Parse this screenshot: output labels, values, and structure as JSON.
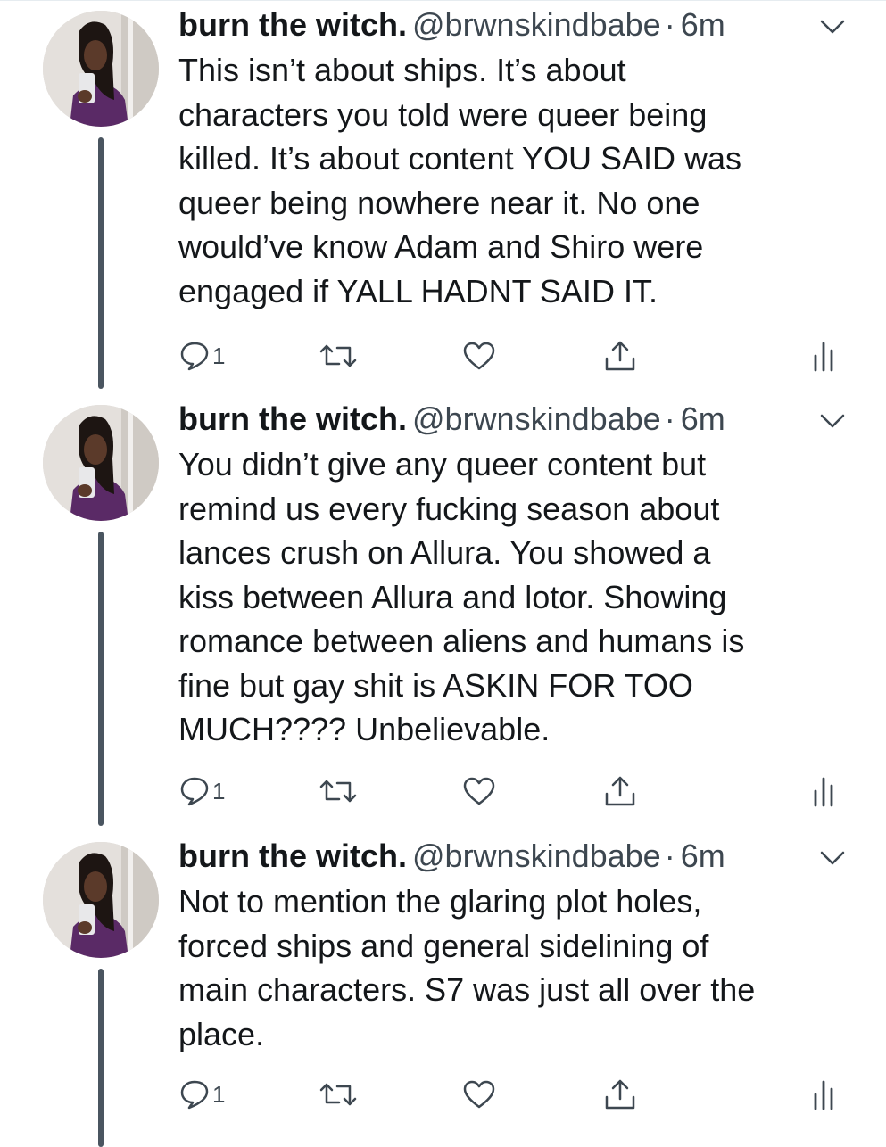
{
  "tweets": [
    {
      "display_name": "burn the witch.",
      "handle": "@brwnskindbabe",
      "separator": "·",
      "time": "6m",
      "text": "This isn’t about ships. It’s about\ncharacters you told were queer being\nkilled. It’s about content YOU SAID was\nqueer being nowhere near it. No one\nwould’ve know Adam and Shiro were\nengaged if YALL HADNT SAID IT.",
      "reply_count": "1"
    },
    {
      "display_name": "burn the witch.",
      "handle": "@brwnskindbabe",
      "separator": "·",
      "time": "6m",
      "text": "You didn’t give any queer content but\nremind us every fucking season about\nlances crush on Allura. You showed a\nkiss between Allura and lotor. Showing\nromance between aliens and humans is\nfine but gay shit is ASKIN FOR TOO\nMUCH???? Unbelievable.",
      "reply_count": "1"
    },
    {
      "display_name": "burn the witch.",
      "handle": "@brwnskindbabe",
      "separator": "·",
      "time": "6m",
      "text": "Not to mention the glaring plot holes,\nforced ships and general sidelining of\nmain characters. S7 was just all over the\nplace.",
      "reply_count": "1"
    }
  ],
  "icons": {
    "reply": "reply-icon",
    "retweet": "retweet-icon",
    "like": "heart-icon",
    "share": "share-icon",
    "analytics": "analytics-icon",
    "menu": "chevron-down-icon"
  },
  "colors": {
    "text": "#14171a",
    "secondary": "#3d4750",
    "thread_line": "#4a5560"
  }
}
